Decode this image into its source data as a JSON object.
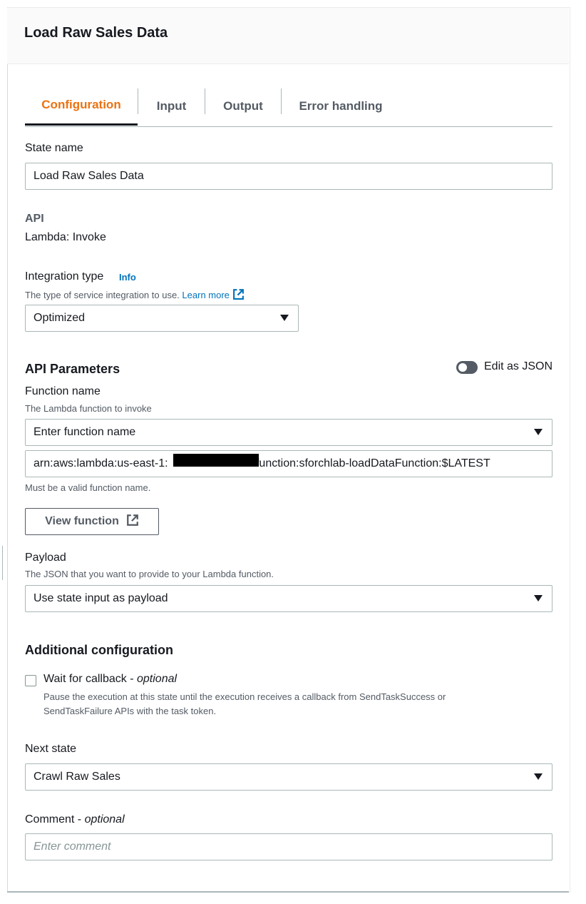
{
  "header": {
    "title": "Load Raw Sales Data"
  },
  "tabs": [
    {
      "label": "Configuration",
      "active": true
    },
    {
      "label": "Input",
      "active": false
    },
    {
      "label": "Output",
      "active": false
    },
    {
      "label": "Error handling",
      "active": false
    }
  ],
  "state_name": {
    "label": "State name",
    "value": "Load Raw Sales Data"
  },
  "api": {
    "label": "API",
    "value": "Lambda: Invoke"
  },
  "integration_type": {
    "label": "Integration type",
    "info": "Info",
    "description": "The type of service integration to use.",
    "learn_more": "Learn more",
    "selected": "Optimized"
  },
  "api_parameters": {
    "title": "API Parameters",
    "edit_as_json": "Edit as JSON",
    "edit_as_json_enabled": false
  },
  "function_name": {
    "label": "Function name",
    "description": "The Lambda function to invoke",
    "select_placeholder": "Enter function name",
    "arn_prefix": "arn:aws:lambda:us-east-1:",
    "arn_suffix": ":function:sforchlab-loadDataFunction:$LATEST",
    "validation": "Must be a valid function name.",
    "view_button": "View function"
  },
  "payload": {
    "label": "Payload",
    "description": "The JSON that you want to provide to your Lambda function.",
    "selected": "Use state input as payload"
  },
  "additional_configuration": {
    "title": "Additional configuration",
    "callback_label": "Wait for callback - ",
    "callback_optional": "optional",
    "callback_checked": false,
    "callback_desc_line1": "Pause the execution at this state until the execution receives a callback from SendTaskSuccess or",
    "callback_desc_line2": "SendTaskFailure APIs with the task token."
  },
  "next_state": {
    "label": "Next state",
    "selected": "Crawl Raw Sales"
  },
  "comment": {
    "label": "Comment - ",
    "optional": "optional",
    "placeholder": "Enter comment"
  },
  "colors": {
    "accent": "#ec7211",
    "link": "#0073bb",
    "text": "#16191f",
    "secondary": "#545b64",
    "border": "#aab7b8"
  }
}
